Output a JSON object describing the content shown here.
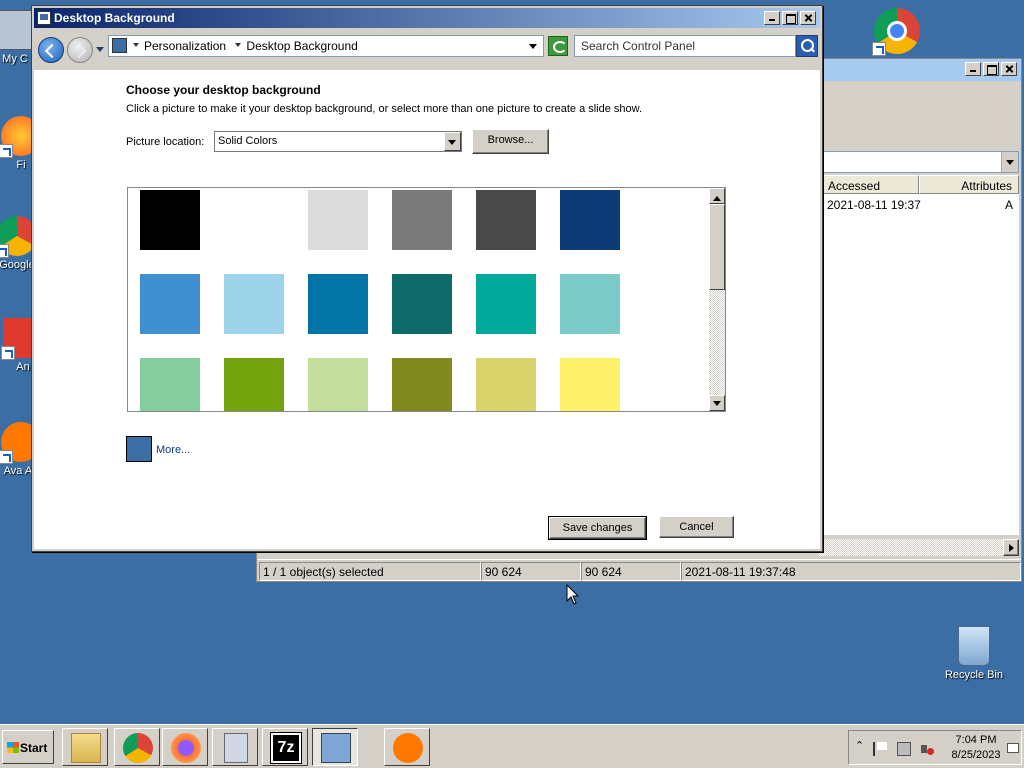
{
  "desktop": {
    "icons": [
      {
        "label": "My C"
      },
      {
        "label": "Fi"
      },
      {
        "label": "Google"
      },
      {
        "label": "An"
      },
      {
        "label": "Ava An"
      },
      {
        "label": "Recycle Bin"
      }
    ]
  },
  "background_window": {
    "columns": [
      "Accessed",
      "Attributes"
    ],
    "row": {
      "accessed": "2021-08-11 19:37",
      "attributes": "A"
    },
    "status": [
      "1 / 1 object(s) selected",
      "90 624",
      "90 624",
      "2021-08-11 19:37:48"
    ]
  },
  "dialog": {
    "title": "Desktop Background",
    "breadcrumb": [
      "Personalization",
      "Desktop Background"
    ],
    "search_placeholder": "Search Control Panel",
    "heading": "Choose your desktop background",
    "subtext": "Click a picture to make it your desktop background, or select more than one picture to create a slide show.",
    "picture_location_label": "Picture location:",
    "picture_location_value": "Solid Colors",
    "browse_label": "Browse...",
    "swatch_colors": [
      "#000000",
      "#ffffff",
      "#dcdcdc",
      "#7a7a7a",
      "#494949",
      "#0d3b75",
      "#3f8fd1",
      "#9dd4ea",
      "#0075a6",
      "#0f6a6a",
      "#00a99a",
      "#7ccbc9",
      "#85cc9f",
      "#75a30e",
      "#c3de9c",
      "#808a1e",
      "#d8d46b",
      "#fdf269"
    ],
    "more_color": "#3a6ea5",
    "more_label": "More...",
    "save_label": "Save changes",
    "cancel_label": "Cancel"
  },
  "taskbar": {
    "start_label": "Start",
    "apps": [
      "file-manager",
      "chrome",
      "firefox",
      "calculator",
      "7zip",
      "control-panel",
      "avast"
    ],
    "clock_time": "7:04 PM",
    "clock_date": "8/25/2023"
  }
}
